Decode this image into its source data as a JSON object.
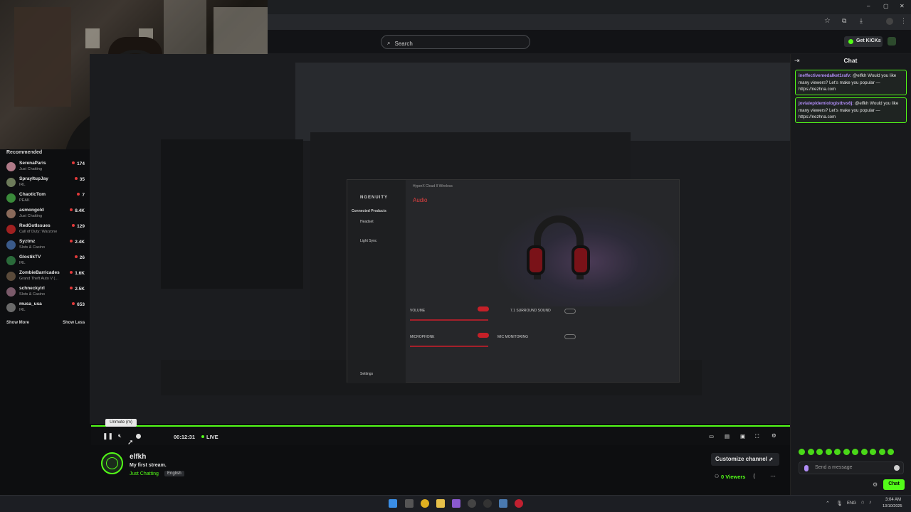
{
  "browser": {
    "window_controls": [
      "–",
      "▢",
      "✕"
    ],
    "search_placeholder": "Search",
    "get_kicks": "Get KICKs"
  },
  "recommended": {
    "title": "Recommended",
    "items": [
      {
        "name": "SerenaParis",
        "category": "Just Chatting",
        "viewers": "174",
        "color": "#b07a88"
      },
      {
        "name": "SprayItupJay",
        "category": "IRL",
        "viewers": "35",
        "color": "#6d7b5a"
      },
      {
        "name": "ChaoticTom",
        "category": "PEAK",
        "viewers": "7",
        "color": "#3a8a3a"
      },
      {
        "name": "asmongold",
        "category": "Just Chatting",
        "viewers": "8.4K",
        "color": "#8a6a5a"
      },
      {
        "name": "RedGotIssues",
        "category": "Call of Duty: Warzone",
        "viewers": "129",
        "color": "#a02020"
      },
      {
        "name": "Syztmz",
        "category": "Slots & Casino",
        "viewers": "2.4K",
        "color": "#3a5a8a"
      },
      {
        "name": "GlostikTV",
        "category": "IRL",
        "viewers": "26",
        "color": "#2a6a3a"
      },
      {
        "name": "ZombieBarricades",
        "category": "Grand Theft Auto V (...",
        "viewers": "1.6K",
        "color": "#5a4a3a"
      },
      {
        "name": "schneckyirl",
        "category": "Slots & Casino",
        "viewers": "2.5K",
        "color": "#7a5a6a"
      },
      {
        "name": "musa_usa",
        "category": "IRL",
        "viewers": "653",
        "color": "#6a6a6a"
      }
    ],
    "show_more": "Show More",
    "show_less": "Show Less"
  },
  "ngenuity": {
    "brand": "NGENUITY",
    "connected_products": "Connected Products",
    "headset": "Headset",
    "light_sync": "Light Sync",
    "settings": "Settings",
    "device_title": "HyperX Cloud II Wireless",
    "audio_tab": "Audio",
    "volume": "VOLUME",
    "microphone": "MICROPHONE",
    "surround": "7.1 SURROUND SOUND",
    "mic_monitoring": "MIC MONITORING"
  },
  "player": {
    "tooltip": "Unmute (m)",
    "time": "00:12:31",
    "live": "LIVE"
  },
  "channel": {
    "name": "elfkh",
    "stream_title": "My first stream.",
    "category": "Just Chatting",
    "language": "English",
    "customize": "Customize channel",
    "viewers": "0 Viewers"
  },
  "chat": {
    "title": "Chat",
    "messages": [
      {
        "user": "ineffectivemedalket1rafv:",
        "text": "@elfkh Would you like many viewers? Let's make you popular — https://nezhna.com"
      },
      {
        "user": "jovialepidemiologistbvs6j:",
        "text": "@elfkh Would you like many viewers? Let's make you popular — https://nezhna.com"
      }
    ],
    "input_placeholder": "Send a message",
    "send_label": "Chat"
  },
  "taskbar": {
    "lang": "ENG",
    "time": "3:04 AM",
    "date": "13/10/2025"
  },
  "colors": {
    "accent": "#53fc18",
    "bg": "#0d0e10"
  }
}
